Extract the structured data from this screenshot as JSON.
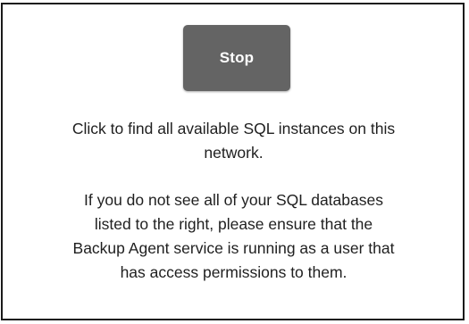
{
  "stop_button": {
    "label": "Stop"
  },
  "instruction": {
    "line1": "Click to find all available SQL instances on this",
    "line2": "network."
  },
  "info": {
    "line1": "If you do not see all of your SQL databases",
    "line2": "listed to the right, please ensure that the",
    "line3": "Backup Agent service is running as a user that",
    "line4": "has access permissions to them."
  },
  "colors": {
    "button_background": "#646464",
    "button_text": "#ffffff",
    "panel_border": "#1a1a1a",
    "body_text": "#1f1f1f"
  }
}
